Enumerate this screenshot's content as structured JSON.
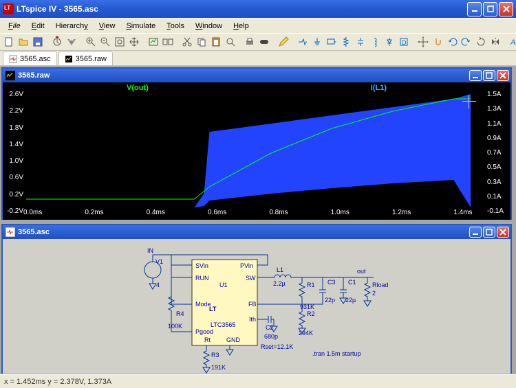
{
  "app": {
    "title": "LTspice IV - 3565.asc"
  },
  "menus": [
    "File",
    "Edit",
    "Hierarchy",
    "View",
    "Simulate",
    "Tools",
    "Window",
    "Help"
  ],
  "tabs": [
    {
      "name": "3565.asc",
      "icon": "schematic"
    },
    {
      "name": "3565.raw",
      "icon": "waveform"
    }
  ],
  "children": {
    "wave": {
      "title": "3565.raw"
    },
    "sch": {
      "title": "3565.asc"
    }
  },
  "statusbar": "x = 1.452ms     y = 2.378V, 1.373A",
  "chart_data": {
    "type": "line",
    "title": "",
    "xlabel": "",
    "ylabel_left": "",
    "ylabel_right": "",
    "x_ticks": [
      "0.0ms",
      "0.2ms",
      "0.4ms",
      "0.6ms",
      "0.8ms",
      "1.0ms",
      "1.2ms",
      "1.4ms"
    ],
    "left_ticks": [
      "2.6V",
      "2.2V",
      "1.8V",
      "1.4V",
      "1.0V",
      "0.6V",
      "0.2V",
      "-0.2V"
    ],
    "right_ticks": [
      "1.5A",
      "1.3A",
      "1.1A",
      "0.9A",
      "0.7A",
      "0.5A",
      "0.3A",
      "0.1A",
      "-0.1A"
    ],
    "xlim": [
      0.0,
      1.5
    ],
    "ylim_left": [
      -0.2,
      2.6
    ],
    "ylim_right": [
      -0.1,
      1.5
    ],
    "series": [
      {
        "name": "V(out)",
        "color": "#00ff00",
        "axis": "left",
        "x": [
          0.0,
          0.55,
          0.6,
          0.8,
          1.0,
          1.2,
          1.4,
          1.45
        ],
        "y": [
          0.0,
          0.0,
          0.3,
          1.2,
          1.8,
          2.2,
          2.5,
          2.5
        ]
      },
      {
        "name": "I(L1)",
        "color": "#3388ff",
        "axis": "right",
        "x": [
          0.0,
          0.55,
          0.6,
          0.8,
          1.0,
          1.2,
          1.4,
          1.45
        ],
        "y_low": [
          0.0,
          0.0,
          0.0,
          0.1,
          0.2,
          0.3,
          0.4,
          0.4
        ],
        "y_high": [
          0.0,
          0.0,
          0.8,
          1.0,
          1.15,
          1.3,
          1.45,
          1.5
        ]
      }
    ]
  },
  "schematic": {
    "ic": {
      "ref": "U1",
      "part": "LTC3565",
      "pins_left": [
        "SVin",
        "RUN",
        "Mode",
        "Pgood",
        "Rt"
      ],
      "pins_right": [
        "PVin",
        "SW",
        "FB",
        "Ith",
        "GND"
      ]
    },
    "parts": {
      "V1": "V1",
      "IN": "IN",
      "gnd_v1": "",
      "R4": "R4",
      "R4_val": "100K",
      "R3": "R3",
      "R3_val": "191K",
      "C2": "C2",
      "C2_val": "680p",
      "Rset": "Rset=12.1K",
      "L1": "L1",
      "L1_val": "2.2µ",
      "R1": "R1",
      "R1_val": "931K",
      "C3": "C3",
      "C3_val": "22p",
      "C1": "C1",
      "C1_val": "22µ",
      "R2": "R2",
      "R2_val": "294K",
      "Rload": "Rload",
      "Rload_val": "2",
      "out": "out",
      "sim_cmd": ".tran 1.5m startup"
    }
  },
  "toolbar_icons": [
    "new",
    "open",
    "save",
    "mail",
    "print",
    "sep",
    "cut",
    "copy",
    "paste",
    "find",
    "sep",
    "zoom-area",
    "zoom-back",
    "zoom-fit",
    "pan",
    "sep",
    "autorange",
    "pick-visible",
    "sep",
    "run",
    "halt",
    "sep",
    "place-resistor",
    "place-cap",
    "place-inductor",
    "place-diode",
    "place-wire",
    "place-gnd",
    "place-label",
    "place-net",
    "sep",
    "component",
    "rotate-left",
    "rotate-right",
    "mirror",
    "sep",
    "move",
    "drag",
    "delete",
    "duplicate",
    "sep",
    "text",
    "spice-directive"
  ]
}
